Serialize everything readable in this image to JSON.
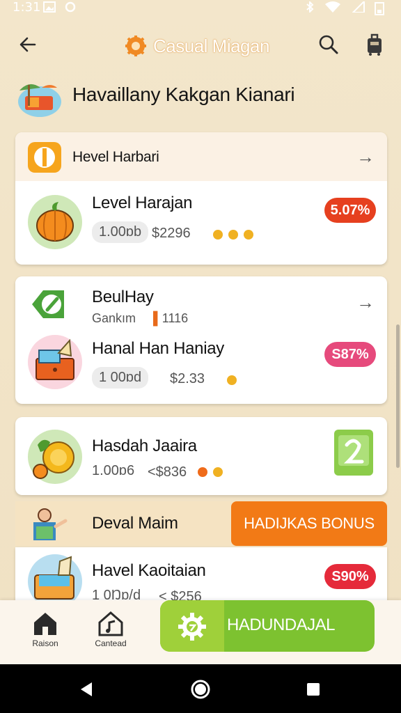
{
  "status_bar": {
    "time": "1:31"
  },
  "app_bar": {
    "title": "Casual Miagan"
  },
  "header": {
    "title": "Havaillany Kakgan Kianari"
  },
  "section1": {
    "head_label": "Hevel Harbari",
    "item": {
      "title": "Level Harajan",
      "qty": "1.00ɒb",
      "price": "$2296",
      "dots": 3,
      "badge": "5.07%",
      "badge_color": "#e6401f"
    }
  },
  "section2": {
    "head_title": "BeulHay",
    "head_sub": "Gankım",
    "head_num": "1116",
    "item": {
      "title": "Hanal Han Haniay",
      "qty": "1 00ɒd",
      "price": "$2.33",
      "dots": 1,
      "badge": "S87%",
      "badge_color": "#e64a7c"
    }
  },
  "section3": {
    "item": {
      "title": "Hasdah Jaaira",
      "qty": "1.00ɒ6",
      "price": "<$836",
      "dots": 2
    }
  },
  "section4": {
    "label": "Deval Maim",
    "bonus_button": "HADIJKAS BONUS",
    "item": {
      "title": "Havel Kaoitaian",
      "qty": "1 0Ŋɒ/d",
      "price": "< $256",
      "badge": "S90%",
      "badge_color": "#e52a3a"
    }
  },
  "bottom_nav": {
    "items": [
      {
        "label": "Raison",
        "icon": "home-icon"
      },
      {
        "label": "Cantead",
        "icon": "music-home-icon"
      }
    ],
    "cta_label": "HADUNDAJAL"
  },
  "colors": {
    "accent_orange": "#f27a16",
    "accent_green": "#7dc230",
    "background": "#f2e4c8"
  }
}
